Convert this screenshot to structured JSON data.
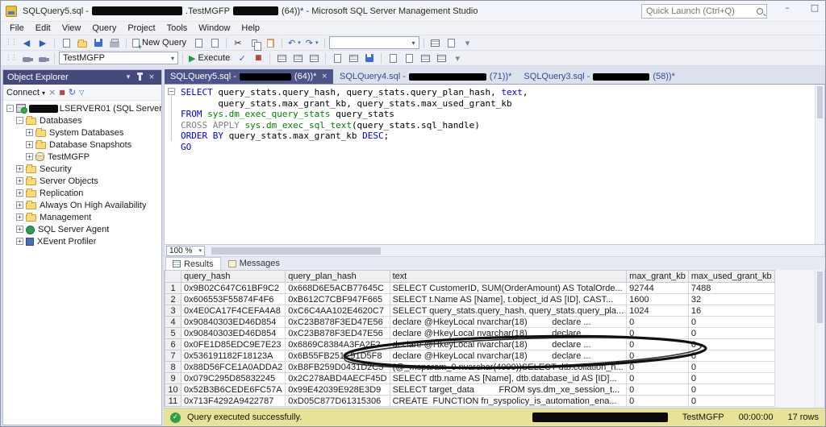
{
  "icons": {
    "back": "◀",
    "forward": "▶",
    "undo": "↶",
    "redo": "↷",
    "cut": "✂",
    "dropdown": "▾",
    "check": "✓",
    "play": "▶",
    "stop": "■",
    "minimize": "–",
    "maximize": "□",
    "close": "×",
    "refresh": "↻",
    "filter": "▽",
    "collapse_minus": "−",
    "grip": "⋮⋮"
  },
  "titlebar": {
    "title_part1": "SQLQuery5.sql -",
    "title_part2": ".TestMGFP",
    "title_part3": "(64))* - Microsoft SQL Server Management Studio",
    "quick_launch_placeholder": "Quick Launch (Ctrl+Q)"
  },
  "menubar": {
    "items": [
      "File",
      "Edit",
      "View",
      "Query",
      "Project",
      "Tools",
      "Window",
      "Help"
    ]
  },
  "toolbar": {
    "new_query_label": "New Query",
    "execute_label": "Execute",
    "database_combo_value": "TestMGFP"
  },
  "object_explorer": {
    "title": "Object Explorer",
    "connect_label": "Connect",
    "tree": [
      {
        "indent": 0,
        "expander": "-",
        "icon": "server",
        "redact": "show",
        "label": "LSERVER01 (SQL Server"
      },
      {
        "indent": 12,
        "expander": "-",
        "icon": "folder",
        "redact": "",
        "label": "Databases"
      },
      {
        "indent": 24,
        "expander": "+",
        "icon": "folder",
        "redact": "",
        "label": "System Databases"
      },
      {
        "indent": 24,
        "expander": "+",
        "icon": "folder",
        "redact": "",
        "label": "Database Snapshots"
      },
      {
        "indent": 24,
        "expander": "+",
        "icon": "database",
        "redact": "",
        "label": "TestMGFP"
      },
      {
        "indent": 12,
        "expander": "+",
        "icon": "folder",
        "redact": "",
        "label": "Security"
      },
      {
        "indent": 12,
        "expander": "+",
        "icon": "folder",
        "redact": "",
        "label": "Server Objects"
      },
      {
        "indent": 12,
        "expander": "+",
        "icon": "folder",
        "redact": "",
        "label": "Replication"
      },
      {
        "indent": 12,
        "expander": "+",
        "icon": "folder",
        "redact": "",
        "label": "Always On High Availability"
      },
      {
        "indent": 12,
        "expander": "+",
        "icon": "folder",
        "redact": "",
        "label": "Management"
      },
      {
        "indent": 12,
        "expander": "+",
        "icon": "agent",
        "redact": "",
        "label": "SQL Server Agent"
      },
      {
        "indent": 12,
        "expander": "+",
        "icon": "profiler",
        "redact": "",
        "label": "XEvent Profiler"
      }
    ]
  },
  "tabs": [
    {
      "prefix": "SQLQuery5.sql - ",
      "suffix": "(64))*",
      "state": "active",
      "redact_w": 64
    },
    {
      "prefix": "SQLQuery4.sql - ",
      "suffix": "(71))*",
      "state": "",
      "redact_w": 96
    },
    {
      "prefix": "SQLQuery3.sql - ",
      "suffix": "(58))*",
      "state": "",
      "redact_w": 70
    }
  ],
  "editor": {
    "zoom": "100 %",
    "lines": [
      [
        [
          "kw",
          "SELECT"
        ],
        [
          "pl",
          " query_stats.query_hash, query_stats.query_plan_hash, "
        ],
        [
          "kw",
          "text"
        ],
        [
          "pl",
          ","
        ]
      ],
      [
        [
          "pl",
          "       query_stats.max_grant_kb, query_stats.max_used_grant_kb"
        ]
      ],
      [
        [
          "kw",
          "FROM"
        ],
        [
          "pl",
          " "
        ],
        [
          "sys",
          "sys.dm_exec_query_stats"
        ],
        [
          "pl",
          " query_stats"
        ]
      ],
      [
        [
          "gr",
          "CROSS APPLY"
        ],
        [
          "pl",
          " "
        ],
        [
          "sys",
          "sys.dm_exec_sql_text"
        ],
        [
          "pl",
          "(query_stats.sql_handle)"
        ]
      ],
      [
        [
          "kw",
          "ORDER BY"
        ],
        [
          "pl",
          " query_stats.max_grant_kb "
        ],
        [
          "kw",
          "DESC"
        ],
        [
          "pl",
          ";"
        ]
      ],
      [
        [
          "kw",
          "GO"
        ]
      ]
    ]
  },
  "results": {
    "tab_results": "Results",
    "tab_messages": "Messages",
    "columns": [
      "query_hash",
      "query_plan_hash",
      "text",
      "max_grant_kb",
      "max_used_grant_kb"
    ],
    "rows": [
      {
        "num": "1",
        "query_hash": "0x9B02C647C61BF9C2",
        "query_plan_hash": "0x668D6E5ACB77645C",
        "text": "SELECT CustomerID, SUM(OrderAmount) AS TotalOrde...",
        "max_grant_kb": "92744",
        "max_used_grant_kb": "7488"
      },
      {
        "num": "2",
        "query_hash": "0x606553F55874F4F6",
        "query_plan_hash": "0xB612C7CBF947F665",
        "text": "SELECT t.Name AS [Name], t.object_id AS [ID], CAST...",
        "max_grant_kb": "1600",
        "max_used_grant_kb": "32"
      },
      {
        "num": "3",
        "query_hash": "0x4E0CA17F4CEFA4A8",
        "query_plan_hash": "0xC6C4AA102E4620C7",
        "text": "SELECT query_stats.query_hash, query_stats.query_pla...",
        "max_grant_kb": "1024",
        "max_used_grant_kb": "16"
      },
      {
        "num": "4",
        "query_hash": "0x90840303ED46D854",
        "query_plan_hash": "0xC23B878F3ED47E56",
        "text": "declare @HkeyLocal nvarchar(18)          declare ...",
        "max_grant_kb": "0",
        "max_used_grant_kb": "0"
      },
      {
        "num": "5",
        "query_hash": "0x90840303ED46D854",
        "query_plan_hash": "0xC23B878F3ED47E56",
        "text": "declare @HkeyLocal nvarchar(18)          declare ...",
        "max_grant_kb": "0",
        "max_used_grant_kb": "0"
      },
      {
        "num": "6",
        "query_hash": "0x0FE1D85EDC9E7E23",
        "query_plan_hash": "0x6869C8384A3FA2F2",
        "text": "declare @HkeyLocal nvarchar(18)          declare ...",
        "max_grant_kb": "0",
        "max_used_grant_kb": "0"
      },
      {
        "num": "7",
        "query_hash": "0x536191182F18123A",
        "query_plan_hash": "0x6B55FB251E91D5F8",
        "text": "declare @HkeyLocal nvarchar(18)          declare ...",
        "max_grant_kb": "0",
        "max_used_grant_kb": "0"
      },
      {
        "num": "8",
        "query_hash": "0x88D56FCE1A0ADDA2",
        "query_plan_hash": "0xB8FB259D0431D2C5",
        "text": "(@_msparam_0 nvarchar(4000))SELECT dtb.collation_n...",
        "max_grant_kb": "0",
        "max_used_grant_kb": "0"
      },
      {
        "num": "9",
        "query_hash": "0x079C295D85832245",
        "query_plan_hash": "0x2C278ABD4AECF45D",
        "text": "SELECT dtb.name AS [Name], dtb.database_id AS [ID]...",
        "max_grant_kb": "0",
        "max_used_grant_kb": "0"
      },
      {
        "num": "10",
        "query_hash": "0x52B3B6CEDE6FC57A",
        "query_plan_hash": "0x99E42039E928E3D9",
        "text": "SELECT target_data          FROM sys.dm_xe_session_t...",
        "max_grant_kb": "0",
        "max_used_grant_kb": "0"
      },
      {
        "num": "11",
        "query_hash": "0x713F4292A9422787",
        "query_plan_hash": "0xD05C877D61315306",
        "text": "CREATE  FUNCTION fn_syspolicy_is_automation_ena...",
        "max_grant_kb": "0",
        "max_used_grant_kb": "0"
      }
    ]
  },
  "statusbar": {
    "message": "Query executed successfully.",
    "database": "TestMGFP",
    "time": "00:00:00",
    "rows": "17 rows"
  }
}
